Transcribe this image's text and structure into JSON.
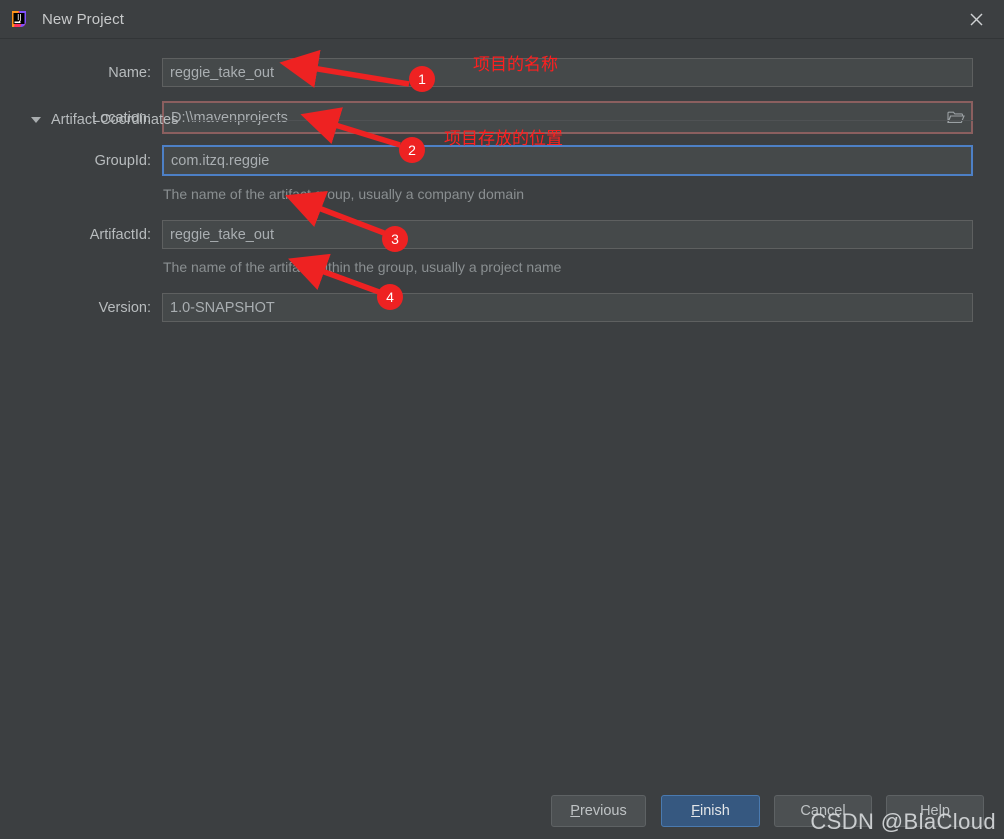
{
  "window": {
    "title": "New Project",
    "app_icon": "intellij-idea-icon",
    "close_icon": "close-icon"
  },
  "form": {
    "fields": [
      {
        "key": "name",
        "label": "Name:",
        "value": "reggie_take_out",
        "state": "normal",
        "hint": ""
      },
      {
        "key": "location",
        "label": "Location:",
        "value": "D:\\\\mavenprojects",
        "state": "warning",
        "hint": "",
        "browse_icon": "folder-icon"
      },
      {
        "key": "groupid",
        "label": "GroupId:",
        "value": "com.itzq.reggie",
        "state": "focused",
        "hint": "The name of the artifact group, usually a company domain"
      },
      {
        "key": "artifactid",
        "label": "ArtifactId:",
        "value": "reggie_take_out",
        "state": "normal",
        "hint": "The name of the artifact within the group, usually a project name"
      },
      {
        "key": "version",
        "label": "Version:",
        "value": "1.0-SNAPSHOT",
        "state": "normal",
        "hint": ""
      }
    ],
    "section": {
      "title": "Artifact Coordinates",
      "expanded": true,
      "disclosure_icon": "triangle-down-icon"
    }
  },
  "buttons": {
    "previous": {
      "label": "Previous",
      "mnemonic": "P",
      "rest": "revious"
    },
    "finish": {
      "label": "Finish",
      "mnemonic": "F",
      "rest": "inish",
      "primary": true
    },
    "cancel": {
      "label": "Cancel",
      "mnemonic": "",
      "rest": "Cancel"
    },
    "help": {
      "label": "Help",
      "mnemonic": "",
      "rest": "Help"
    }
  },
  "annotations": {
    "badges": [
      {
        "number": "1"
      },
      {
        "number": "2"
      },
      {
        "number": "3"
      },
      {
        "number": "4"
      }
    ],
    "notes": [
      {
        "text": "项目的名称"
      },
      {
        "text": "项目存放的位置"
      }
    ],
    "color": "#ee2222"
  },
  "watermark": {
    "text": "CSDN @BlaCloud"
  },
  "colors": {
    "dialog_bg": "#3c3f41",
    "field_bg": "#45494a",
    "field_border": "#5e6060",
    "warn_border": "#8b5f5f",
    "focus_border": "#4d80c6",
    "primary_button": "#365880",
    "annotation_red": "#ee2222",
    "text": "#b8bcbe",
    "hint_text": "#8a8f91"
  }
}
